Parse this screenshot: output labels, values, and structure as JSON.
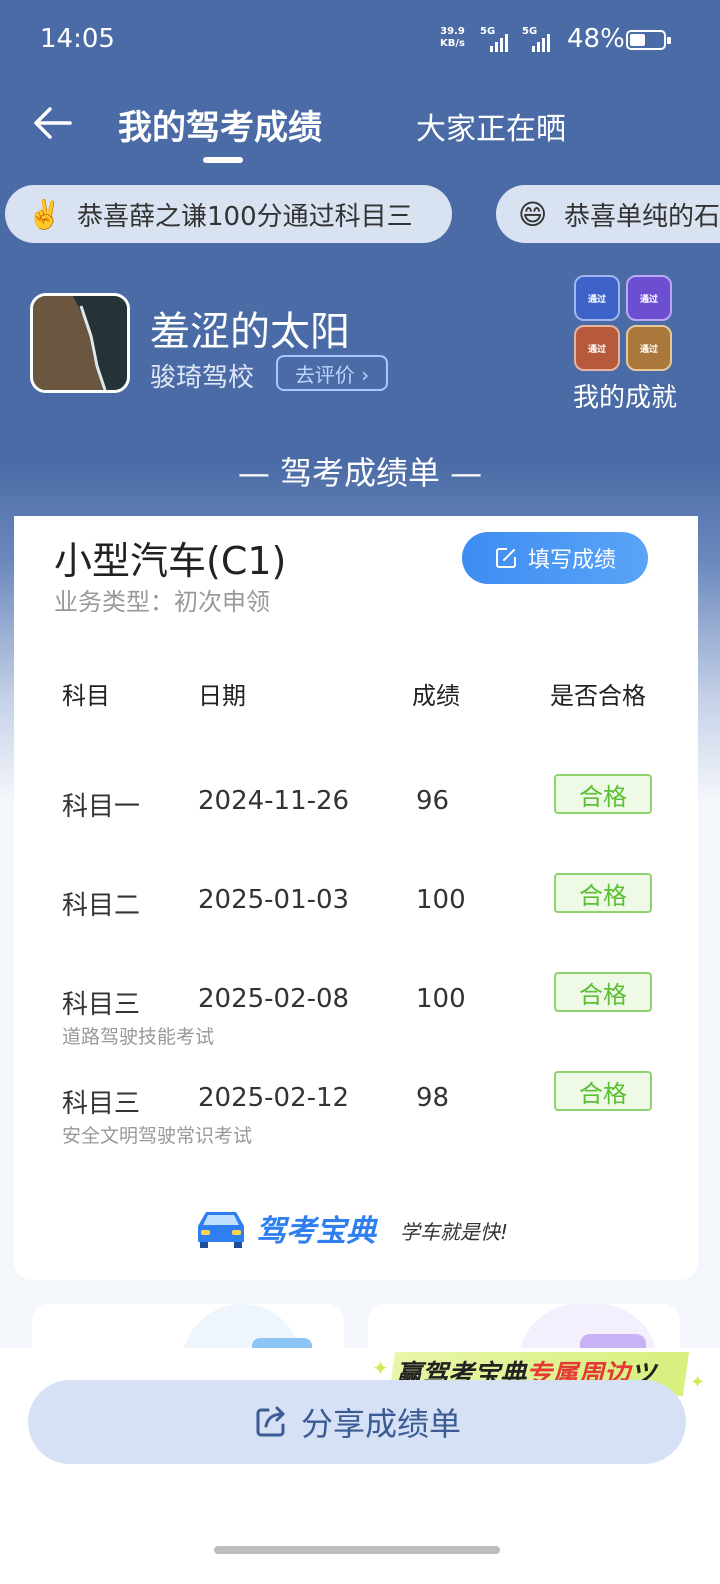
{
  "status": {
    "time": "14:05",
    "net_speed_top": "39.9",
    "net_speed_unit": "KB/s",
    "sig1": "5G",
    "sig2": "5G",
    "battery": "48%",
    "battery_level": 0.48
  },
  "nav": {
    "active_tab": "我的驾考成绩",
    "other_tab": "大家正在晒"
  },
  "ticker": [
    {
      "emoji": "✌️",
      "text": "恭喜薛之谦100分通过科目三"
    },
    {
      "emoji": "😄",
      "text": "恭喜单纯的石"
    }
  ],
  "profile": {
    "name": "羞涩的太阳",
    "school": "骏琦驾校",
    "review_label": "去评价 ›"
  },
  "achievement": {
    "label": "我的成就",
    "badges": [
      "通过",
      "通过",
      "通过",
      "通过"
    ]
  },
  "sheet_title": "— 驾考成绩单 —",
  "card": {
    "vehicle": "小型汽车(C1)",
    "business_type": "业务类型：初次申领",
    "fill_button": "填写成绩",
    "headers": [
      "科目",
      "日期",
      "成绩",
      "是否合格"
    ],
    "rows": [
      {
        "subject": "科目一",
        "date": "2024-11-26",
        "score": "96",
        "status": "合格",
        "note": ""
      },
      {
        "subject": "科目二",
        "date": "2025-01-03",
        "score": "100",
        "status": "合格",
        "note": ""
      },
      {
        "subject": "科目三",
        "date": "2025-02-08",
        "score": "100",
        "status": "合格",
        "note": "道路驾驶技能考试"
      },
      {
        "subject": "科目三",
        "date": "2025-02-12",
        "score": "98",
        "status": "合格",
        "note": "安全文明驾驶常识考试"
      }
    ],
    "brand_name": "驾考宝典",
    "brand_slogan": "学车就是快!"
  },
  "promo": {
    "text_a": "赢驾考宝典",
    "text_b": "专属周边",
    "text_c": "ツ"
  },
  "share_button": "分享成绩单",
  "colors": {
    "header_bg": "#4a6ba6",
    "accent_blue": "#3d8cf2",
    "pass_green": "#5cbf34"
  }
}
